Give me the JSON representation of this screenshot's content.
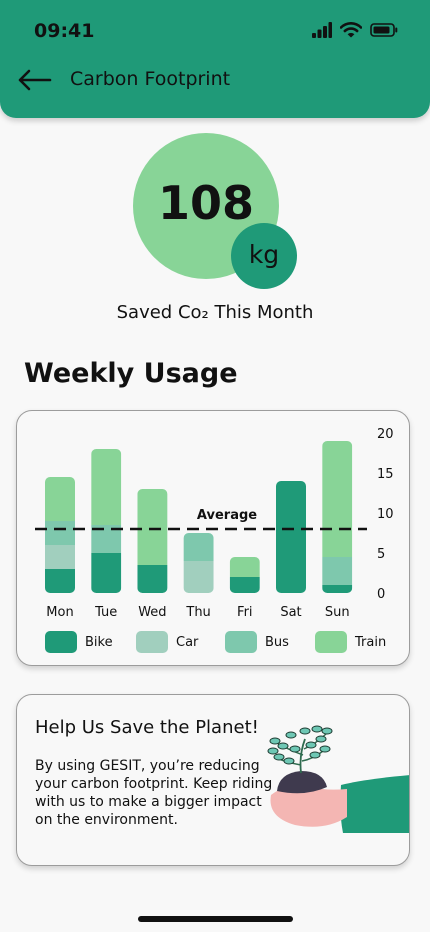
{
  "status_bar": {
    "time": "09:41"
  },
  "header": {
    "title": "Carbon Footprint"
  },
  "summary": {
    "value": "108",
    "unit": "kg",
    "caption": "Saved Co₂ This Month"
  },
  "weekly": {
    "title": "Weekly Usage",
    "average_label": "Average"
  },
  "chart_data": {
    "type": "bar",
    "stacked": true,
    "categories": [
      "Mon",
      "Tue",
      "Wed",
      "Thu",
      "Fri",
      "Sat",
      "Sun"
    ],
    "series": [
      {
        "name": "Bike",
        "values": [
          3,
          5,
          3.5,
          0,
          2,
          14,
          1
        ],
        "color": "#1f9a78"
      },
      {
        "name": "Car",
        "values": [
          3,
          0,
          0,
          4,
          0,
          0,
          0
        ],
        "color": "#a1cfbe"
      },
      {
        "name": "Bus",
        "values": [
          3,
          3.5,
          0,
          3.5,
          0,
          0,
          3.5
        ],
        "color": "#7ec8ad"
      },
      {
        "name": "Train",
        "values": [
          5.5,
          9.5,
          9.5,
          0,
          2.5,
          0,
          14.5
        ],
        "color": "#88d497"
      }
    ],
    "average": 8,
    "ylim": [
      0,
      20
    ],
    "yticks": [
      0,
      5,
      10,
      15,
      20
    ],
    "legend_position": "bottom",
    "grid": false
  },
  "info": {
    "title": "Help Us Save the Planet!",
    "body": "By using GESIT, you’re reducing your carbon footprint. Keep riding with us to make a bigger impact on the environment."
  },
  "colors": {
    "brand": "#1f9a78",
    "accent_light": "#88d497",
    "background": "#f8f8f8"
  },
  "icons": {
    "back": "arrow-left-icon",
    "signal": "cellular-signal-icon",
    "wifi": "wifi-icon",
    "battery": "battery-icon",
    "illustration": "hand-holding-plant-icon"
  }
}
